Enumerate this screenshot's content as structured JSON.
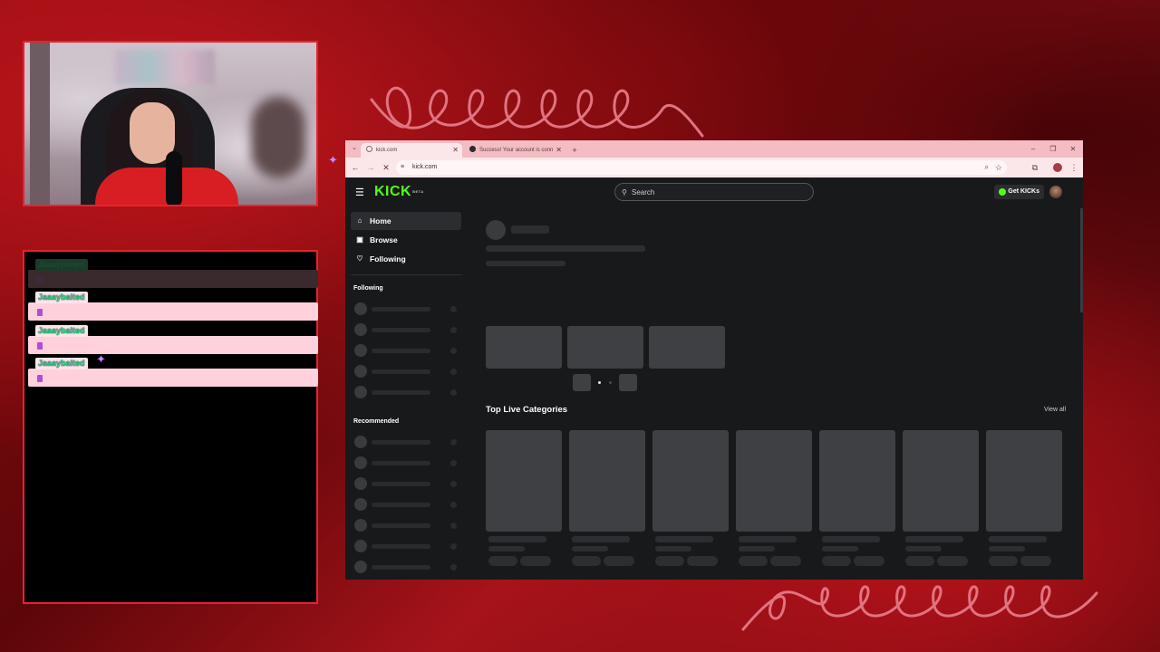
{
  "overlay": {
    "chat_messages": [
      {
        "username": "Jaaaybaited",
        "faded": true
      },
      {
        "username": "Jaaaybaited",
        "faded": false
      },
      {
        "username": "Jaaaybaited",
        "faded": false
      },
      {
        "username": "Jaaaybaited",
        "faded": false
      }
    ]
  },
  "browser": {
    "tabs": [
      {
        "title": "kick.com",
        "active": true
      },
      {
        "title": "Success! Your account is conn",
        "active": false
      }
    ],
    "new_tab_label": "+",
    "window_controls": {
      "minimize": "–",
      "restore": "❐",
      "close": "✕"
    },
    "address": {
      "url": "kick.com"
    },
    "nav": {
      "back": "←",
      "forward": "→",
      "stop": "✕"
    }
  },
  "kick": {
    "logo_text": "KICK",
    "logo_badge": "BETA",
    "search_placeholder": "Search",
    "get_kicks_label": "Get KICKs",
    "sidebar": {
      "nav": [
        {
          "label": "Home",
          "icon": "home-icon",
          "glyph": "⌂",
          "active": true
        },
        {
          "label": "Browse",
          "icon": "browse-icon",
          "glyph": "▣",
          "active": false
        },
        {
          "label": "Following",
          "icon": "heart-icon",
          "glyph": "♡",
          "active": false
        }
      ],
      "following_heading": "Following",
      "recommended_heading": "Recommended"
    },
    "main": {
      "top_live_categories_title": "Top Live Categories",
      "view_all_label": "View all"
    }
  },
  "colors": {
    "kick_green": "#53fc18",
    "overlay_border": "#e8222e",
    "chat_bg": "#ffd1dd",
    "tab_bar": "#f4bcc3"
  }
}
